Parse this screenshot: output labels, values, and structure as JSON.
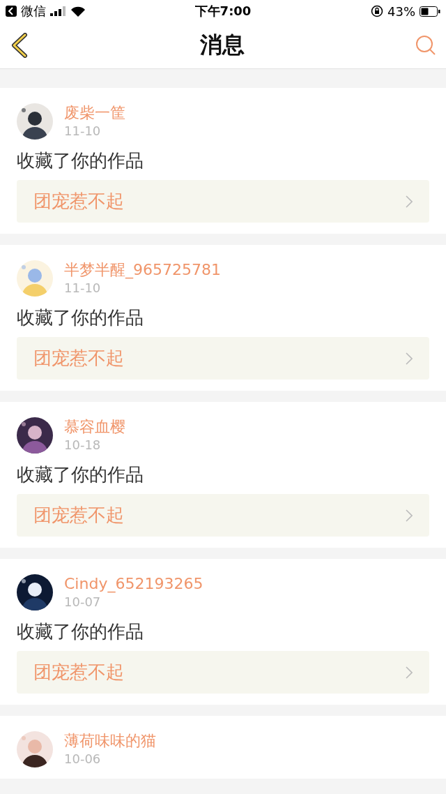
{
  "status_bar": {
    "back_app": "微信",
    "time": "下午7:00",
    "battery": "43%"
  },
  "nav": {
    "title": "消息"
  },
  "messages": [
    {
      "name": "废柴一筐",
      "date": "11-10",
      "action": "收藏了你的作品",
      "work": "团宠惹不起"
    },
    {
      "name": "半梦半醒_965725781",
      "date": "11-10",
      "action": "收藏了你的作品",
      "work": "团宠惹不起"
    },
    {
      "name": "慕容血樱",
      "date": "10-18",
      "action": "收藏了你的作品",
      "work": "团宠惹不起"
    },
    {
      "name": "Cindy_652193265",
      "date": "10-07",
      "action": "收藏了你的作品",
      "work": "团宠惹不起"
    },
    {
      "name": "薄荷味味的猫",
      "date": "10-06"
    }
  ]
}
